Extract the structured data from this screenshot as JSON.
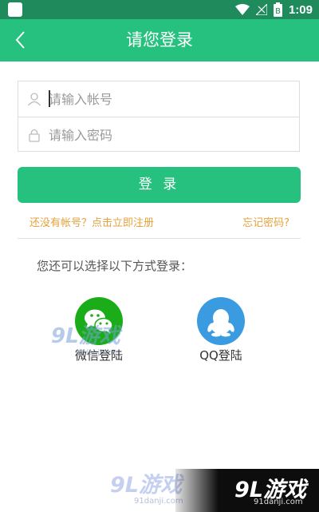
{
  "status_bar": {
    "time": "1:09",
    "battery_label": "B"
  },
  "header": {
    "title": "请您登录"
  },
  "form": {
    "account_placeholder": "请输入帐号",
    "password_placeholder": "请输入密码",
    "login_label": "登 录"
  },
  "links": {
    "register": "还没有帐号？点击立即注册",
    "forgot": "忘记密码?"
  },
  "alt_login": {
    "title": "您还可以选择以下方式登录：",
    "options": [
      {
        "label": "微信登陆",
        "icon": "wechat-icon",
        "color": "#1aad19"
      },
      {
        "label": "QQ登陆",
        "icon": "qq-icon",
        "color": "#3a9be0"
      }
    ]
  },
  "watermark": {
    "brand": "9L游戏",
    "site": "91danji.com"
  },
  "colors": {
    "accent": "#27c17f",
    "status_bar": "#1f8a5c",
    "link": "#e6a23c"
  }
}
